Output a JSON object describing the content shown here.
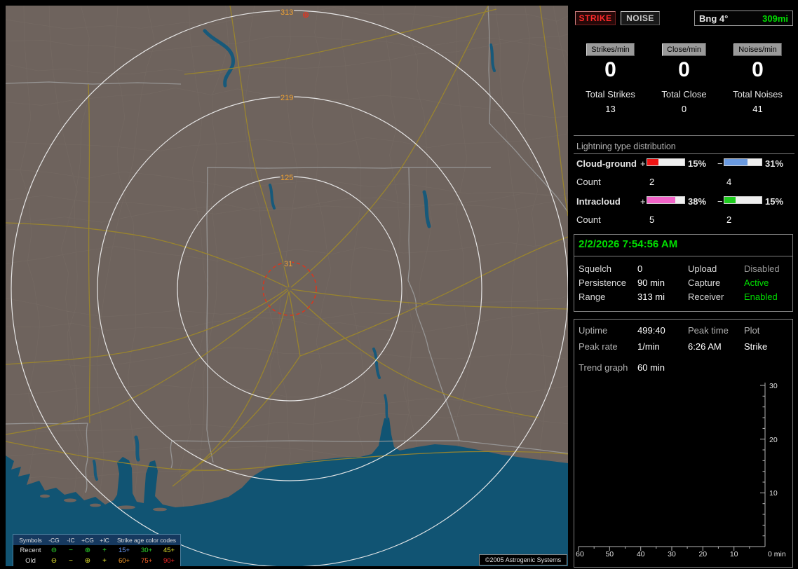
{
  "colors": {
    "green": "#00df00",
    "red": "#ff2a2a",
    "gray": "#9a9a9a"
  },
  "map": {
    "range_ring_labels": [
      "313",
      "219",
      "125",
      "31"
    ],
    "noise_symbol": "⊕",
    "copyright": "©2005 Astrogenic Systems",
    "legend": {
      "symbols_header": "Symbols",
      "symbol_cols": [
        "-CG",
        "-IC",
        "+CG",
        "+IC"
      ],
      "age_header": "Strike age color codes",
      "rows": [
        {
          "label": "Recent",
          "color": "#2ee02e",
          "symbols": [
            "⊖",
            "−",
            "⊕",
            "+"
          ],
          "ages": [
            {
              "text": "15+",
              "color": "#6f9fff"
            },
            {
              "text": "30+",
              "color": "#2ee02e"
            },
            {
              "text": "45+",
              "color": "#e6e62e"
            }
          ]
        },
        {
          "label": "Old",
          "color": "#e6e62e",
          "symbols": [
            "⊖",
            "−",
            "⊕",
            "+"
          ],
          "ages": [
            {
              "text": "60+",
              "color": "#ffa028"
            },
            {
              "text": "75+",
              "color": "#ff6428"
            },
            {
              "text": "90+",
              "color": "#ff2828"
            }
          ]
        }
      ]
    }
  },
  "panel": {
    "strike_button": "STRIKE",
    "noise_button": "NOISE",
    "bearing": "Bng 4°",
    "bearing_range": "309mi",
    "counters": [
      {
        "label": "Strikes/min",
        "value": "0",
        "total_label": "Total Strikes",
        "total_value": "13"
      },
      {
        "label": "Close/min",
        "value": "0",
        "total_label": "Total Close",
        "total_value": "0"
      },
      {
        "label": "Noises/min",
        "value": "0",
        "total_label": "Total Noises",
        "total_value": "41"
      }
    ],
    "distribution": {
      "title": "Lightning type distribution",
      "count_label": "Count",
      "rows": [
        {
          "label": "Cloud-ground",
          "plus": {
            "sign": "+",
            "pct": "15%",
            "count": "2",
            "color": "#f01414",
            "fill": 30
          },
          "minus": {
            "sign": "−",
            "pct": "31%",
            "count": "4",
            "color": "#6a9ae0",
            "fill": 62
          }
        },
        {
          "label": "Intracloud",
          "plus": {
            "sign": "+",
            "pct": "38%",
            "count": "5",
            "color": "#f263c8",
            "fill": 76
          },
          "minus": {
            "sign": "−",
            "pct": "15%",
            "count": "2",
            "color": "#1ecc1e",
            "fill": 30
          }
        }
      ]
    },
    "status": {
      "datetime": "2/2/2026 7:54:56 AM",
      "rows": [
        {
          "key1": "Squelch",
          "val1": "0",
          "key2": "Upload",
          "val2": "Disabled",
          "val2_color": "#9a9a9a"
        },
        {
          "key1": "Persistence",
          "val1": "90 min",
          "key2": "Capture",
          "val2": "Active",
          "val2_color": "#00df00"
        },
        {
          "key1": "Range",
          "val1": "313 mi",
          "key2": "Receiver",
          "val2": "Enabled",
          "val2_color": "#00df00"
        }
      ]
    },
    "stats": {
      "uptime_label": "Uptime",
      "uptime_value": "499:40",
      "peak_time_label": "Peak time",
      "peak_time_value": "6:26 AM",
      "plot_label": "Plot",
      "plot_value": "Strike",
      "peak_rate_label": "Peak rate",
      "peak_rate_value": "1/min",
      "trend_label": "Trend graph",
      "trend_value": "60 min"
    },
    "graph": {
      "y_ticks": [
        "30",
        "20",
        "10"
      ],
      "x_ticks": [
        "60",
        "50",
        "40",
        "30",
        "20",
        "10"
      ],
      "origin_label": "0 min"
    }
  }
}
